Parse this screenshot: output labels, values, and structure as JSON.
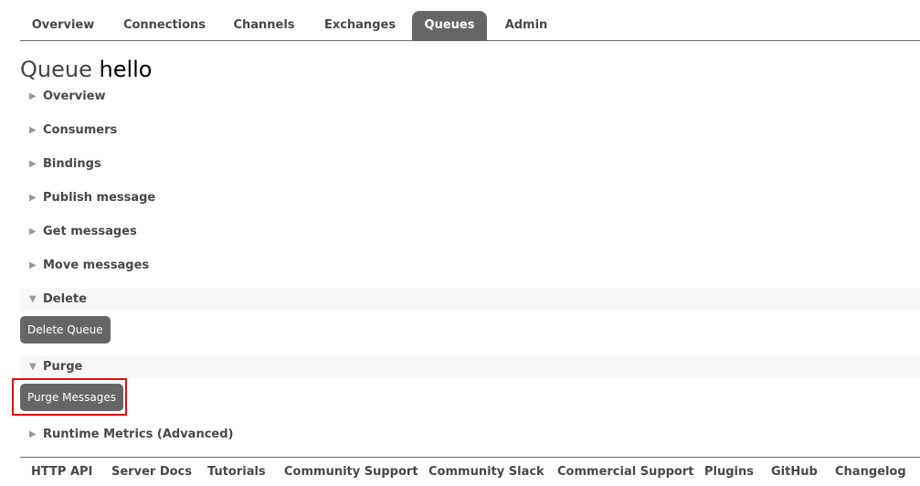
{
  "nav": {
    "tabs": [
      {
        "label": "Overview",
        "active": false
      },
      {
        "label": "Connections",
        "active": false
      },
      {
        "label": "Channels",
        "active": false
      },
      {
        "label": "Exchanges",
        "active": false
      },
      {
        "label": "Queues",
        "active": true
      },
      {
        "label": "Admin",
        "active": false
      }
    ]
  },
  "page": {
    "title_prefix": "Queue",
    "queue_name": "hello"
  },
  "sections": [
    {
      "label": "Overview",
      "expanded": false
    },
    {
      "label": "Consumers",
      "expanded": false
    },
    {
      "label": "Bindings",
      "expanded": false
    },
    {
      "label": "Publish message",
      "expanded": false
    },
    {
      "label": "Get messages",
      "expanded": false
    },
    {
      "label": "Move messages",
      "expanded": false
    },
    {
      "label": "Delete",
      "expanded": true
    },
    {
      "label": "Purge",
      "expanded": true
    },
    {
      "label": "Runtime Metrics (Advanced)",
      "expanded": false
    }
  ],
  "icons": {
    "collapsed": "▶",
    "expanded": "▼"
  },
  "buttons": {
    "delete_queue": "Delete Queue",
    "purge_messages": "Purge Messages"
  },
  "highlight_color": "#e01010",
  "footer": {
    "links": [
      "HTTP API",
      "Server Docs",
      "Tutorials",
      "Community Support",
      "Community Slack",
      "Commercial Support",
      "Plugins",
      "GitHub",
      "Changelog"
    ]
  }
}
